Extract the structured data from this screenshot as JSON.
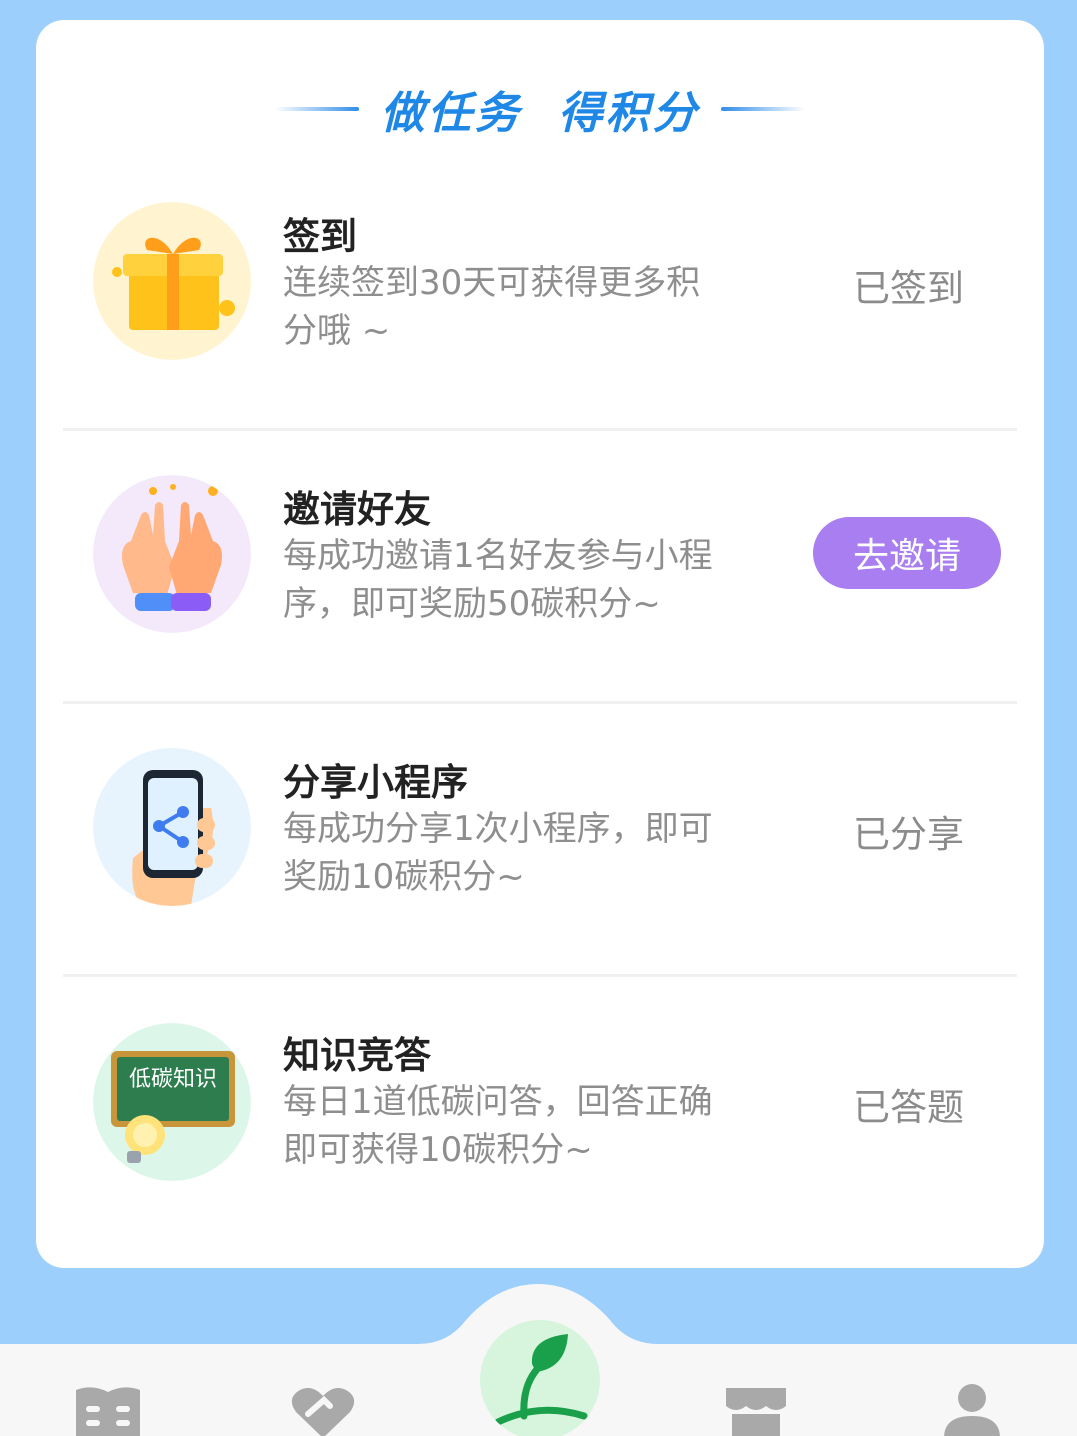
{
  "header": {
    "title": "做任务  得积分"
  },
  "tasks": [
    {
      "title": "签到",
      "description": "连续签到30天可获得更多积分哦 ~",
      "status": "已签到",
      "icon": "gift-icon"
    },
    {
      "title": "邀请好友",
      "description": "每成功邀请1名好友参与小程序，即可奖励50碳积分~",
      "button": "去邀请",
      "icon": "high-five-icon"
    },
    {
      "title": "分享小程序",
      "description": "每成功分享1次小程序，即可奖励10碳积分~",
      "status": "已分享",
      "icon": "share-phone-icon"
    },
    {
      "title": "知识竞答",
      "description": "每日1道低碳问答，回答正确即可获得10碳积分~",
      "status": "已答题",
      "icon": "quiz-board-icon",
      "icon_text": "低碳知识"
    }
  ],
  "tabbar": {
    "items": [
      "book-icon",
      "heart-hand-icon",
      "sprout-icon",
      "store-icon",
      "user-icon"
    ]
  },
  "colors": {
    "background": "#9ccffb",
    "accent": "#1f88e6",
    "invite_button": "#a87ef0"
  }
}
